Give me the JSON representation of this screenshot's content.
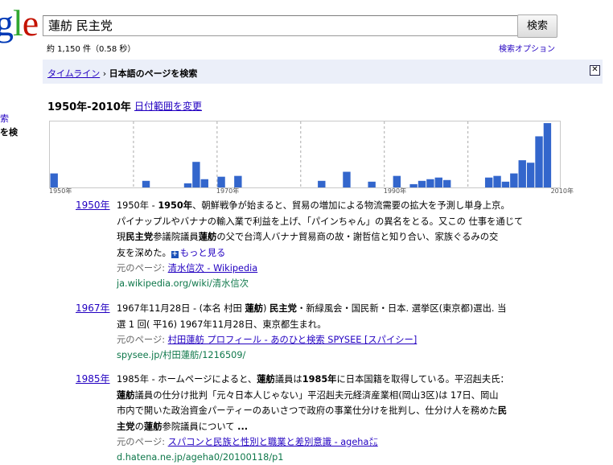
{
  "logo": {
    "g1": "g",
    "l": "l",
    "e": "e"
  },
  "search": {
    "query": "蓮舫 民主党",
    "button": "検索"
  },
  "stats": "約 1,150 件（0.58 秒）",
  "advanced": "検索オプション",
  "left_fragments": [
    "索",
    "を検"
  ],
  "breadcrumb": {
    "link": "タイムライン",
    "sep": " › ",
    "current": "日本語のページを検索"
  },
  "close_label": "✕",
  "range": {
    "title": "1950年-2010年",
    "change": "日付範囲を変更"
  },
  "chart_data": {
    "type": "bar",
    "x_start": 1950,
    "x_end": 2010,
    "tick_labels": [
      "1950年",
      "1970年",
      "1990年",
      "2010年"
    ],
    "ylim": [
      0,
      80
    ],
    "grid": "dashed vertical every 10 years",
    "bar_color": "#3366cc",
    "bars": [
      {
        "year": 1950,
        "value": 17
      },
      {
        "year": 1961,
        "value": 8
      },
      {
        "year": 1966,
        "value": 5
      },
      {
        "year": 1967,
        "value": 31
      },
      {
        "year": 1968,
        "value": 10
      },
      {
        "year": 1970,
        "value": 13
      },
      {
        "year": 1972,
        "value": 14
      },
      {
        "year": 1982,
        "value": 8
      },
      {
        "year": 1985,
        "value": 19
      },
      {
        "year": 1988,
        "value": 7
      },
      {
        "year": 1991,
        "value": 14
      },
      {
        "year": 1993,
        "value": 4
      },
      {
        "year": 1994,
        "value": 8
      },
      {
        "year": 1995,
        "value": 10
      },
      {
        "year": 1996,
        "value": 12
      },
      {
        "year": 1997,
        "value": 9
      },
      {
        "year": 2002,
        "value": 12
      },
      {
        "year": 2003,
        "value": 14
      },
      {
        "year": 2004,
        "value": 7
      },
      {
        "year": 2005,
        "value": 17
      },
      {
        "year": 2006,
        "value": 33
      },
      {
        "year": 2007,
        "value": 30
      },
      {
        "year": 2008,
        "value": 62
      },
      {
        "year": 2009,
        "value": 78
      }
    ]
  },
  "results": [
    {
      "year": "1950年",
      "lines": [
        [
          [
            "1950年 - ",
            false
          ],
          [
            "1950年",
            true
          ],
          [
            "、朝鮮戦争が始まると、貿易の増加による物流需要の拡大を予測し単身上京。",
            false
          ]
        ],
        [
          [
            "パイナップルやバナナの輸入業で利益を上げ、「パインちゃん」の異名をとる。又この 仕事を通じて",
            false
          ]
        ],
        [
          [
            "現",
            false
          ],
          [
            "民主党",
            true
          ],
          [
            "参議院議員",
            false
          ],
          [
            "蓮舫",
            true
          ],
          [
            "の父で台湾人バナナ貿易商の故・謝哲信と知り合い、家族ぐるみの交",
            false
          ]
        ],
        [
          [
            "友を深めた。",
            false
          ]
        ]
      ],
      "more": "もっと見る",
      "src_label": "元のページ: ",
      "src_title": "清水信次 - Wikipedia",
      "url": "ja.wikipedia.org/wiki/清水信次"
    },
    {
      "year": "1967年",
      "lines": [
        [
          [
            "1967年11月28日 - (本名 村田 ",
            false
          ],
          [
            "蓮舫",
            true
          ],
          [
            ") ",
            false
          ],
          [
            "民主党",
            true
          ],
          [
            "・新緑風会・国民新・日本. 選挙区(東京都)選出. 当",
            false
          ]
        ],
        [
          [
            "選 1 回( 平16) 1967年11月28日、東京都生まれ。",
            false
          ]
        ]
      ],
      "src_label": "元のページ: ",
      "src_title": "村田蓮舫 プロフィール - あのひと検索 SPYSEE [スパイシー]",
      "url": "spysee.jp/村田蓮舫/1216509/"
    },
    {
      "year": "1985年",
      "lines": [
        [
          [
            "1985年 - ホームページによると、",
            false
          ],
          [
            "蓮舫",
            true
          ],
          [
            "議員は",
            false
          ],
          [
            "1985年",
            true
          ],
          [
            "に日本国籍を取得している。平沼赳夫氏：",
            false
          ]
        ],
        [
          [
            "蓮舫",
            true
          ],
          [
            "議員の仕分け批判「元々日本人じゃない」平沼赳夫元経済産業相(岡山3区)は 17日、岡山",
            false
          ]
        ],
        [
          [
            "市内で開いた政治資金パーティーのあいさつで政府の事業仕分けを批判し、仕分け人を務めた",
            false
          ],
          [
            "民",
            true
          ]
        ],
        [
          [
            "主党",
            true
          ],
          [
            "の",
            false
          ],
          [
            "蓮舫",
            true
          ],
          [
            "参院議員について ",
            false
          ],
          [
            "...",
            true
          ]
        ]
      ],
      "src_label": "元のページ: ",
      "src_title": "スパコンと民族と性別と職業と差別意識 - ageha㍍",
      "url": "d.hatena.ne.jp/ageha0/20100118/p1"
    }
  ]
}
